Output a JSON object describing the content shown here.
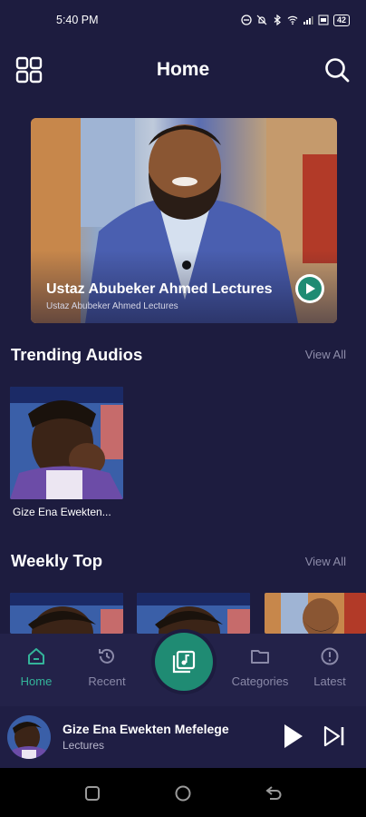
{
  "status_bar": {
    "time": "5:40 PM",
    "battery": "42"
  },
  "header": {
    "title": "Home",
    "menu_icon": "grid-icon",
    "search_icon": "search-icon"
  },
  "featured": {
    "title": "Ustaz Abubeker Ahmed Lectures",
    "subtitle": "Ustaz Abubeker Ahmed Lectures",
    "play_icon": "play-icon"
  },
  "trending": {
    "title": "Trending Audios",
    "view_all": "View All",
    "items": [
      {
        "caption": "Gize Ena Ewekten..."
      }
    ]
  },
  "weekly": {
    "title": "Weekly Top",
    "view_all": "View All"
  },
  "nav": {
    "items": [
      {
        "label": "Home",
        "icon": "home-icon",
        "active": true
      },
      {
        "label": "Recent",
        "icon": "history-icon",
        "active": false
      },
      {
        "label": "Categories",
        "icon": "folder-icon",
        "active": false
      },
      {
        "label": "Latest",
        "icon": "info-icon",
        "active": false
      }
    ],
    "fab_icon": "library-music-icon"
  },
  "player": {
    "title": "Gize Ena Ewekten Mefelege",
    "subtitle": "Lectures"
  },
  "colors": {
    "background": "#1d1c3f",
    "accent": "#1f8b73",
    "active_nav": "#34b49a",
    "muted": "#8d8ca9"
  }
}
